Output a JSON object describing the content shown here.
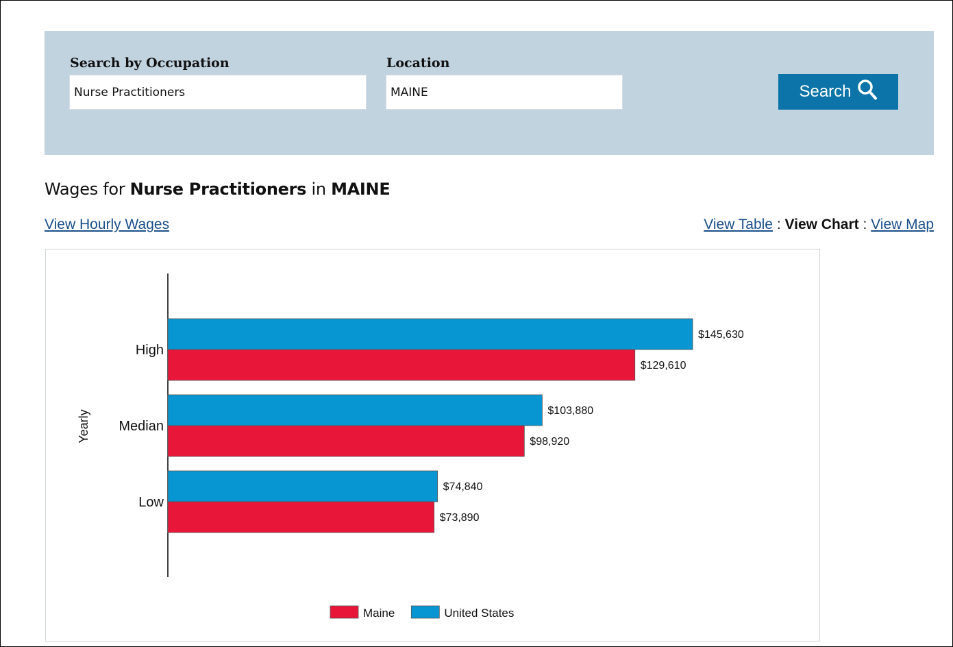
{
  "search": {
    "occupation_label": "Search by Occupation",
    "occupation_value": "Nurse Practitioners",
    "location_label": "Location",
    "location_value": "MAINE",
    "button_label": "Search"
  },
  "heading": {
    "prefix": "Wages for ",
    "occupation": "Nurse Practitioners",
    "middle": " in ",
    "location": "MAINE"
  },
  "links": {
    "hourly": "View Hourly Wages",
    "table": "View Table",
    "separator": " : ",
    "chart": "View Chart",
    "map": "View Map"
  },
  "colors": {
    "maine": "#e8173a",
    "united_states": "#0896d3"
  },
  "chart_data": {
    "type": "bar",
    "orientation": "horizontal",
    "ylabel": "Yearly",
    "categories": [
      "High",
      "Median",
      "Low"
    ],
    "series": [
      {
        "name": "United States",
        "values": [
          145630,
          103880,
          74840
        ],
        "labels": [
          "$145,630",
          "$103,880",
          "$74,840"
        ]
      },
      {
        "name": "Maine",
        "values": [
          129610,
          98920,
          73890
        ],
        "labels": [
          "$129,610",
          "$98,920",
          "$73,890"
        ]
      }
    ],
    "xlim": [
      0,
      145630
    ],
    "grid": false,
    "legend": {
      "position": "bottom",
      "items": [
        "Maine",
        "United States"
      ]
    }
  }
}
